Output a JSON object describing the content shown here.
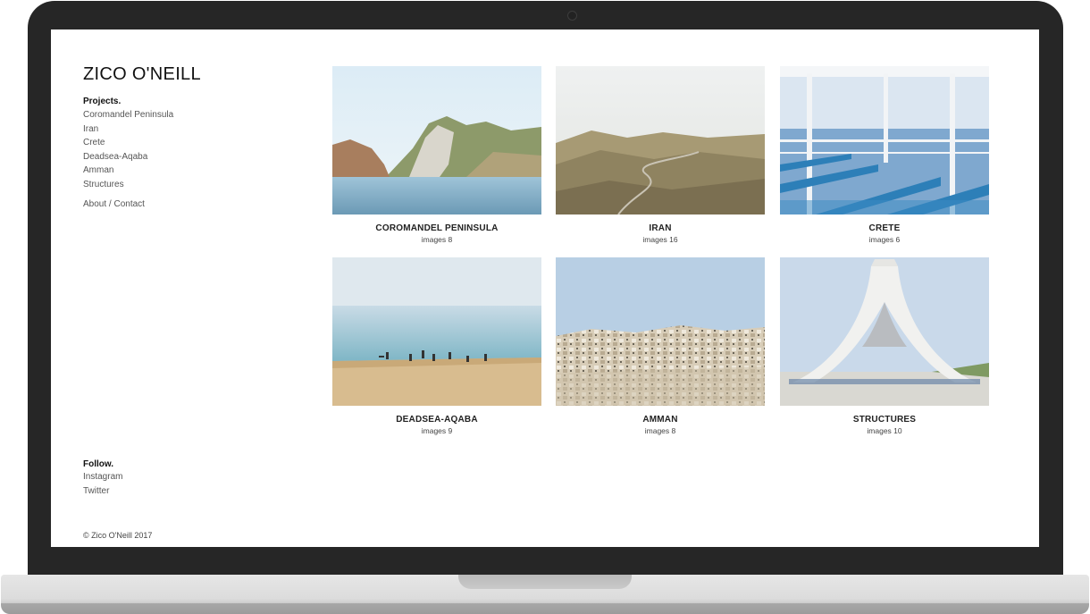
{
  "site": {
    "brand": "ZICO O'NEILL",
    "copyright": "© Zico O'Neill 2017"
  },
  "nav": {
    "projects_heading": "Projects.",
    "projects": [
      {
        "label": "Coromandel Peninsula"
      },
      {
        "label": "Iran"
      },
      {
        "label": "Crete"
      },
      {
        "label": "Deadsea-Aqaba"
      },
      {
        "label": "Amman"
      },
      {
        "label": "Structures"
      }
    ],
    "about": "About / Contact",
    "follow_heading": "Follow.",
    "social": [
      {
        "label": "Instagram"
      },
      {
        "label": "Twitter"
      }
    ]
  },
  "gallery": [
    {
      "title": "COROMANDEL PENINSULA",
      "count": "images 8"
    },
    {
      "title": "IRAN",
      "count": "images 16"
    },
    {
      "title": "CRETE",
      "count": "images 6"
    },
    {
      "title": "DEADSEA-AQABA",
      "count": "images 9"
    },
    {
      "title": "AMMAN",
      "count": "images 8"
    },
    {
      "title": "STRUCTURES",
      "count": "images 10"
    }
  ]
}
